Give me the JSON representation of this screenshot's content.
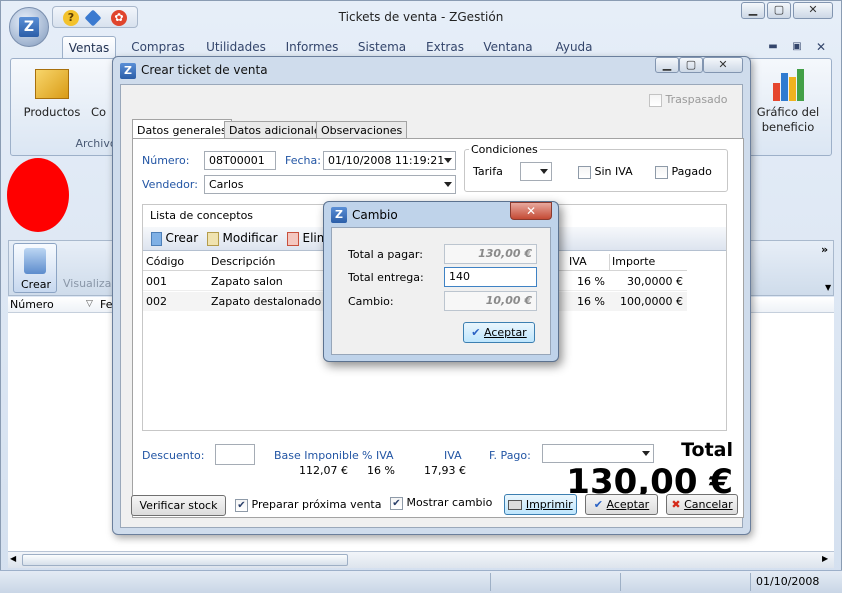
{
  "app": {
    "title": "Tickets de venta - ZGestión",
    "orb_letter": "Z",
    "menu": [
      "Ventas",
      "Compras",
      "Utilidades",
      "Informes",
      "Sistema",
      "Extras",
      "Ventana",
      "Ayuda"
    ],
    "ribbon": {
      "productos": "Productos",
      "co": "Co",
      "archivo_group": "Archivo",
      "grafico": "Gráfico del beneficio"
    },
    "crear_label": "Crear",
    "visualizar_label": "Visualizar",
    "list_cols": [
      "Número",
      "Fe"
    ],
    "status_date": "01/10/2008"
  },
  "dialog": {
    "title": "Crear ticket de venta",
    "tabs": [
      "Datos generales",
      "Datos adicionales",
      "Observaciones"
    ],
    "traspasado": "Traspasado",
    "numero_label": "Número:",
    "numero_value": "08T00001",
    "fecha_label": "Fecha:",
    "fecha_value": "01/10/2008 11:19:21",
    "vendedor_label": "Vendedor:",
    "vendedor_value": "Carlos",
    "condiciones": "Condiciones",
    "tarifa": "Tarifa",
    "sin_iva": "Sin IVA",
    "pagado": "Pagado",
    "lista_conceptos": "Lista de conceptos",
    "toolbar": {
      "crear": "Crear",
      "modificar": "Modificar",
      "eliminar": "Elim"
    },
    "grid_headers": {
      "codigo": "Código",
      "descripcion": "Descripción",
      "iva": "IVA",
      "importe": "Importe"
    },
    "rows": [
      {
        "codigo": "001",
        "descripcion": "Zapato salon",
        "iva": "16 %",
        "importe": "30,0000 €"
      },
      {
        "codigo": "002",
        "descripcion": "Zapato destalonado",
        "iva": "16 %",
        "importe": "100,0000 €"
      }
    ],
    "descuento": "Descuento:",
    "base_imponible_label": "Base Imponible",
    "base_imponible": "112,07 €",
    "pct_iva_label": "% IVA",
    "pct_iva": "16 %",
    "iva_label": "IVA",
    "iva": "17,93 €",
    "fpago": "F. Pago:",
    "total_label": "Total",
    "total": "130,00 €",
    "verificar_stock": "Verificar stock",
    "preparar": "Preparar próxima venta",
    "mostrar_cambio": "Mostrar cambio",
    "imprimir": "Imprimir",
    "aceptar": "Aceptar",
    "cancelar": "Cancelar"
  },
  "cambio": {
    "title": "Cambio",
    "total_pagar_label": "Total a pagar:",
    "total_pagar": "130,00 €",
    "total_entrega_label": "Total entrega:",
    "total_entrega": "140",
    "cambio_label": "Cambio:",
    "cambio_value": "10,00 €",
    "aceptar": "Aceptar"
  },
  "colors": {
    "accent_blue": "#2255a4",
    "red": "#ff0000"
  }
}
